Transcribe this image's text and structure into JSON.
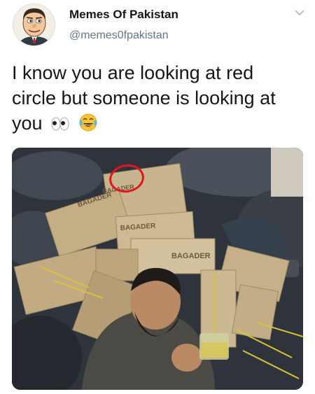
{
  "author": {
    "display_name": "Memes Of Pakistan",
    "handle": "@memes0fpakistan",
    "avatar_icon": "cartoon-face-avatar"
  },
  "menu": {
    "icon": "chevron-down-icon"
  },
  "tweet": {
    "text_line1": "I know you are looking at red",
    "text_line2": "circle but someone is looking at",
    "text_line3": "you",
    "emojis": [
      "eyes-emoji",
      "tears-of-joy-emoji"
    ]
  },
  "media": {
    "box_label_1": "BAGADER",
    "box_label_2": "BAGADER",
    "box_label_3": "BAGADER",
    "box_label_4": "BAGADER",
    "highlight_color": "#e0161c"
  }
}
